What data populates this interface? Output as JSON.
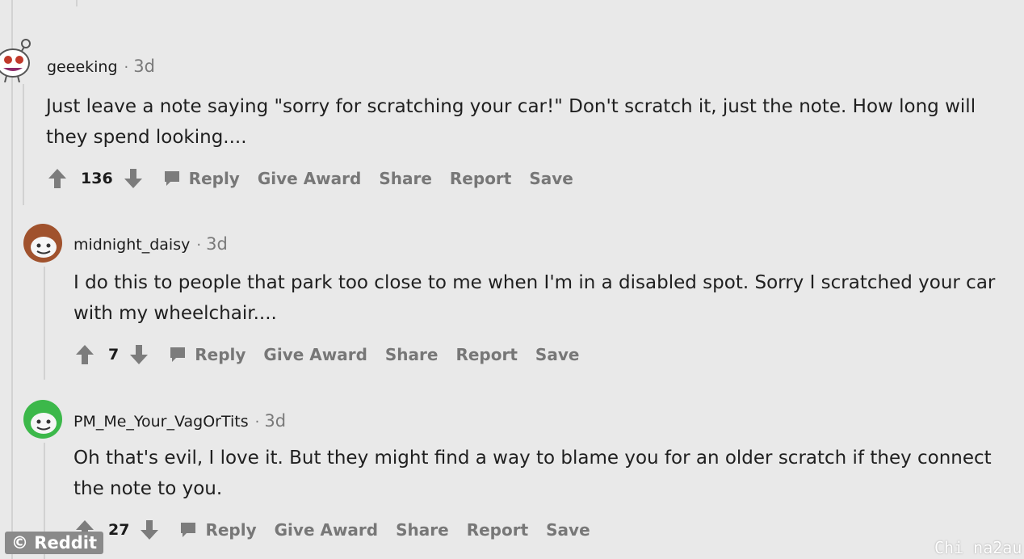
{
  "comments": [
    {
      "username": "geeeking",
      "time": "3d",
      "body": "Just leave a note saying \"sorry for scratching your car!\" Don't scratch it, just the note. How long will they spend looking....",
      "score": "136",
      "avatar_color": "#c0392b"
    },
    {
      "username": "midnight_daisy",
      "time": "3d",
      "body": "I do this to people that park too close to me when I'm in a disabled spot. Sorry I scratched your car with my wheelchair....",
      "score": "7",
      "avatar_color": "#a0522d"
    },
    {
      "username": "PM_Me_Your_VagOrTits",
      "time": "3d",
      "body": "Oh that's evil, I love it. But they might find a way to blame you for an older scratch if they connect the note to you.",
      "score": "27",
      "avatar_color": "#3cb84a"
    }
  ],
  "actions": {
    "reply": "Reply",
    "give_award": "Give Award",
    "share": "Share",
    "report": "Report",
    "save": "Save"
  },
  "watermarks": {
    "left": "© Reddit",
    "right": "Chi na2au"
  },
  "icons": [
    "upvote-icon",
    "downvote-icon",
    "reply-bubble-icon",
    "avatar-icon"
  ]
}
